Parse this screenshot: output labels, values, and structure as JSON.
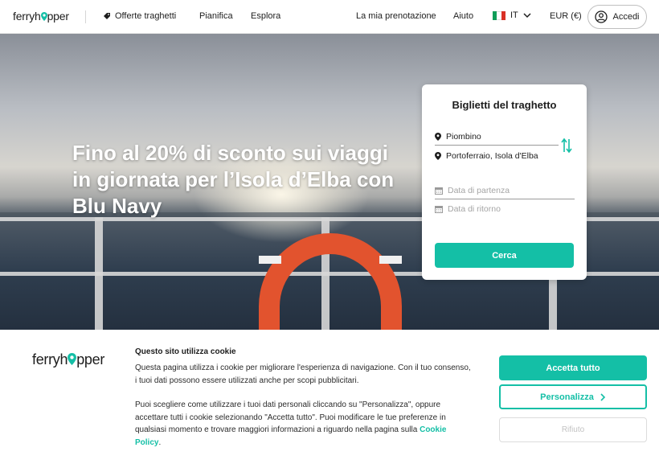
{
  "header": {
    "logo_text_a": "ferryh",
    "logo_text_b": "pper",
    "nav": {
      "offers": "Offerte traghetti",
      "plan": "Pianifica",
      "explore": "Esplora",
      "booking": "La mia prenotazione",
      "help": "Aiuto",
      "language": "IT",
      "currency": "EUR (€)",
      "login": "Accedi"
    }
  },
  "hero": {
    "title": "Fino al 20% di sconto sui viaggi in giornata per l’Isola d’Elba con Blu Navy"
  },
  "booking_card": {
    "title": "Biglietti del traghetto",
    "from": "Piombino",
    "to": "Portoferraio, Isola d'Elba",
    "departure_placeholder": "Data di partenza",
    "return_placeholder": "Data di ritorno",
    "search_label": "Cerca"
  },
  "cookie_banner": {
    "logo_text_a": "ferryh",
    "logo_text_b": "pper",
    "title": "Questo sito utilizza cookie",
    "paragraph1": "Questa pagina utilizza i cookie per migliorare l'esperienza di navigazione. Con il tuo consenso, i tuoi dati possono essere utilizzati anche per scopi pubblicitari.",
    "paragraph2": "Puoi scegliere come utilizzare i tuoi dati personali cliccando su \"Personalizza\", oppure accettare tutti i cookie selezionando \"Accetta tutto\". Puoi modificare le tue preferenze in qualsiasi momento e trovare maggiori informazioni a riguardo nella pagina sulla",
    "policy_link": "Cookie Policy",
    "policy_suffix": ".",
    "accept_label": "Accetta tutto",
    "customize_label": "Personalizza",
    "refuse_label": "Rifiuto"
  },
  "colors": {
    "accent": "#14bfa6",
    "buoy": "#e2532e"
  },
  "icons": [
    "tag-icon",
    "italy-flag-icon",
    "chevron-down-icon",
    "user-circle-icon",
    "location-pin-icon",
    "swap-icon",
    "calendar-icon",
    "chevron-right-icon"
  ]
}
